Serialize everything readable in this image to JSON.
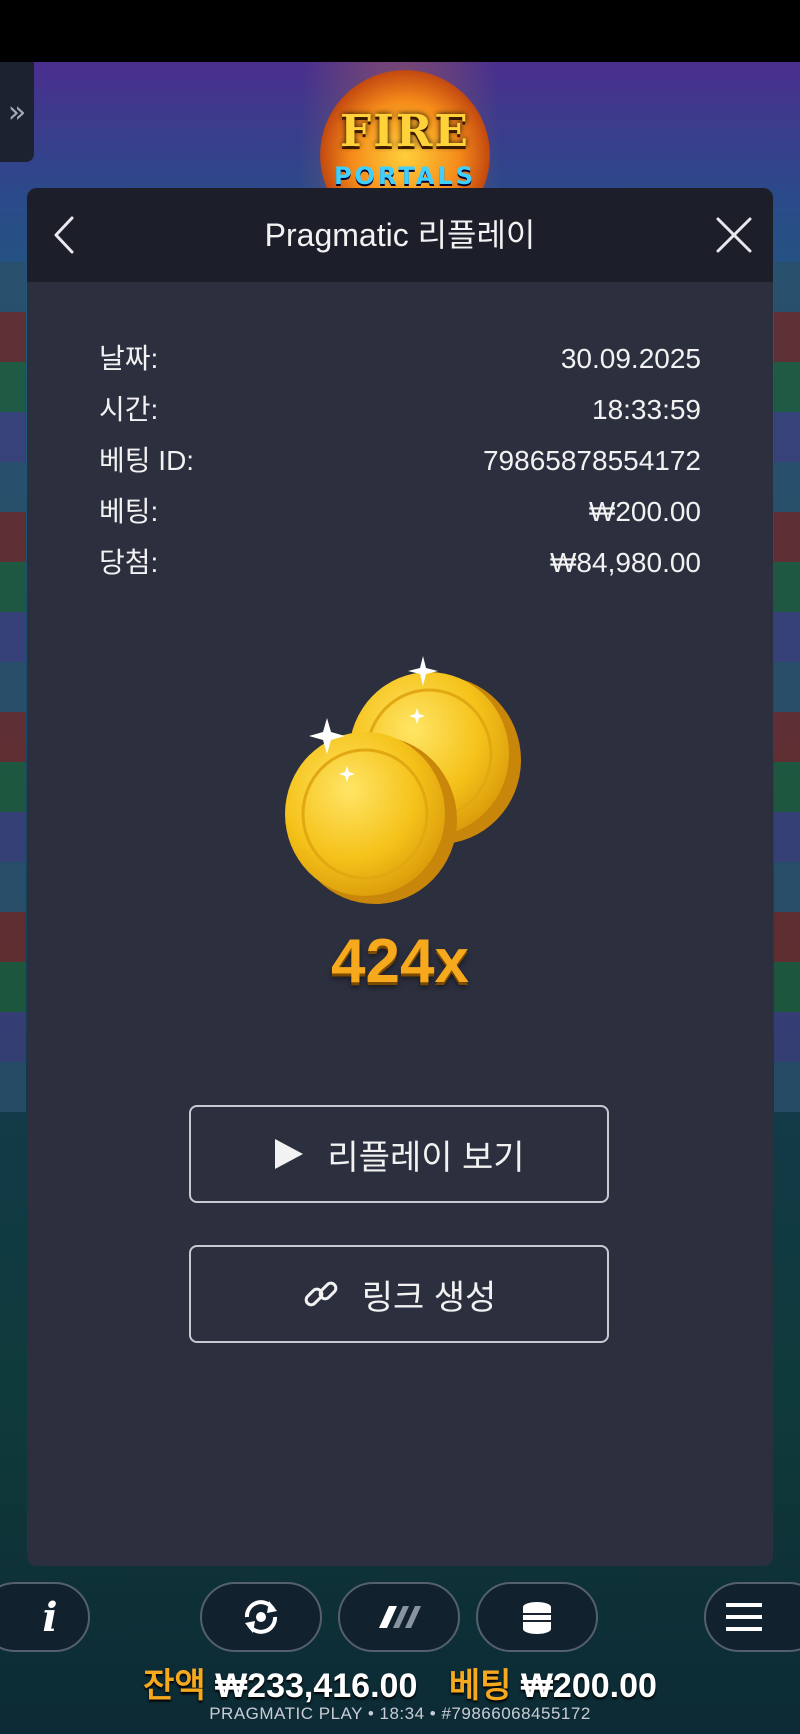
{
  "game": {
    "logo_title": "FIRE",
    "logo_subtitle": "PORTALS"
  },
  "modal": {
    "title": "Pragmatic 리플레이",
    "info": [
      {
        "label": "날짜:",
        "value": "30.09.2025"
      },
      {
        "label": "시간:",
        "value": "18:33:59"
      },
      {
        "label": "베팅 ID:",
        "value": "79865878554172"
      },
      {
        "label": "베팅:",
        "value": "₩200.00"
      },
      {
        "label": "당첨:",
        "value": "₩84,980.00"
      }
    ],
    "multiplier": "424x",
    "buttons": {
      "replay": "리플레이 보기",
      "link": "링크 생성"
    }
  },
  "bottom": {
    "balance_label": "잔액",
    "balance_value": "₩233,416.00",
    "bet_label": "베팅",
    "bet_value": "₩200.00",
    "footer": "PRAGMATIC PLAY • 18:34 • #79866068455172"
  },
  "icons": {
    "side_toggle": "double-chevron-right-icon",
    "back": "chevron-left-icon",
    "close": "close-icon",
    "coins": "gold-coins-icon",
    "play": "play-icon",
    "link": "link-icon",
    "info": "info-icon",
    "autoplay": "autoplay-icon",
    "turbo": "turbo-icon",
    "bet": "coin-stack-icon",
    "menu": "hamburger-menu-icon"
  },
  "colors": {
    "accent": "#f7a91e",
    "modal_bg": "#2c2f3e",
    "header_bg": "#1c1e2a"
  }
}
